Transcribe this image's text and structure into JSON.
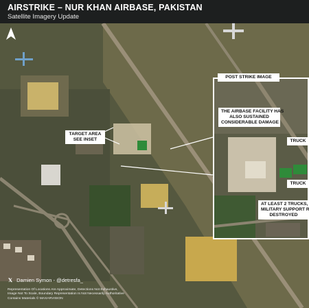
{
  "header": {
    "title": "AIRSTRIKE – NUR KHAN AIRBASE, PAKISTAN",
    "subtitle": "Satellite Imagery Update"
  },
  "labels": {
    "target_area": [
      "TARGET AREA",
      "SEE INSET"
    ],
    "post_strike": "POST STRIKE IMAGE",
    "airbase_damage": [
      "THE AIRBASE FACILITY HAS",
      "ALSO SUSTAINED",
      "CONSIDERABLE DAMAGE"
    ],
    "truck_1": "TRUCK",
    "truck_2": "TRUCK",
    "trucks_destroyed": [
      "AT LEAST 2 TRUCKS, LIK",
      "MILITARY SUPPORT RELA",
      "DESTROYED"
    ]
  },
  "footer": {
    "credit": "Damien Symon - @detresfa_",
    "disclaimer": [
      "Representation Of Locations Are Approximate, Detections Not Exhaustive,",
      "Image Not To Scale, Boundary Representation Is Not Necessarily Authoritative",
      "Contains Materials © MAXARVISION"
    ]
  },
  "icons": {
    "north_arrow": "north-arrow-icon",
    "x_logo": "x-logo-icon"
  },
  "colors": {
    "header_bg": "#14161a",
    "label_bg": "#ffffff",
    "inset_border": "#ffffff"
  }
}
